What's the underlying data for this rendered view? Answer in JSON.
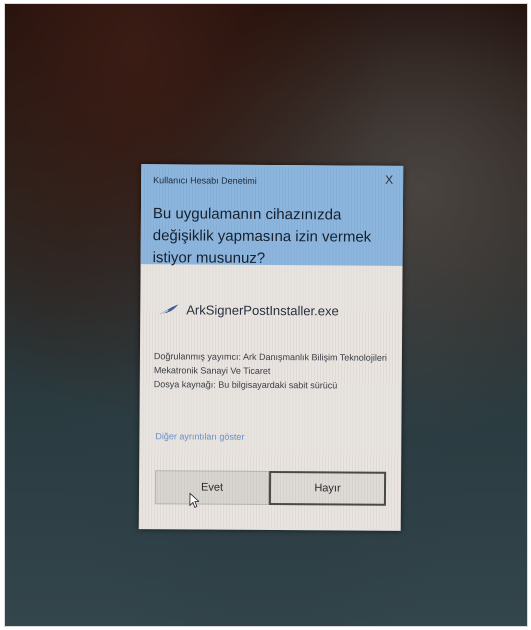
{
  "dialog": {
    "title": "Kullanıcı Hesabı Denetimi",
    "close_symbol": "X",
    "question": "Bu uygulamanın cihazınızda değişiklik yapmasına izin vermek istiyor musunuz?",
    "app": {
      "icon": "arksigner-feather-icon",
      "name": "ArkSignerPostInstaller.exe"
    },
    "publisher_line": "Doğrulanmış yayımcı: Ark Danışmanlık Bilişim Teknolojileri Mekatronik Sanayi Ve Ticaret",
    "origin_line": "Dosya kaynağı: Bu bilgisayardaki sabit sürücü",
    "more_details": "Diğer ayrıntıları göster",
    "buttons": {
      "yes": "Evet",
      "no": "Hayır"
    }
  },
  "colors": {
    "header": "#8cb6de",
    "dialog_body": "#e9e4e0",
    "link": "#6a92c8"
  }
}
